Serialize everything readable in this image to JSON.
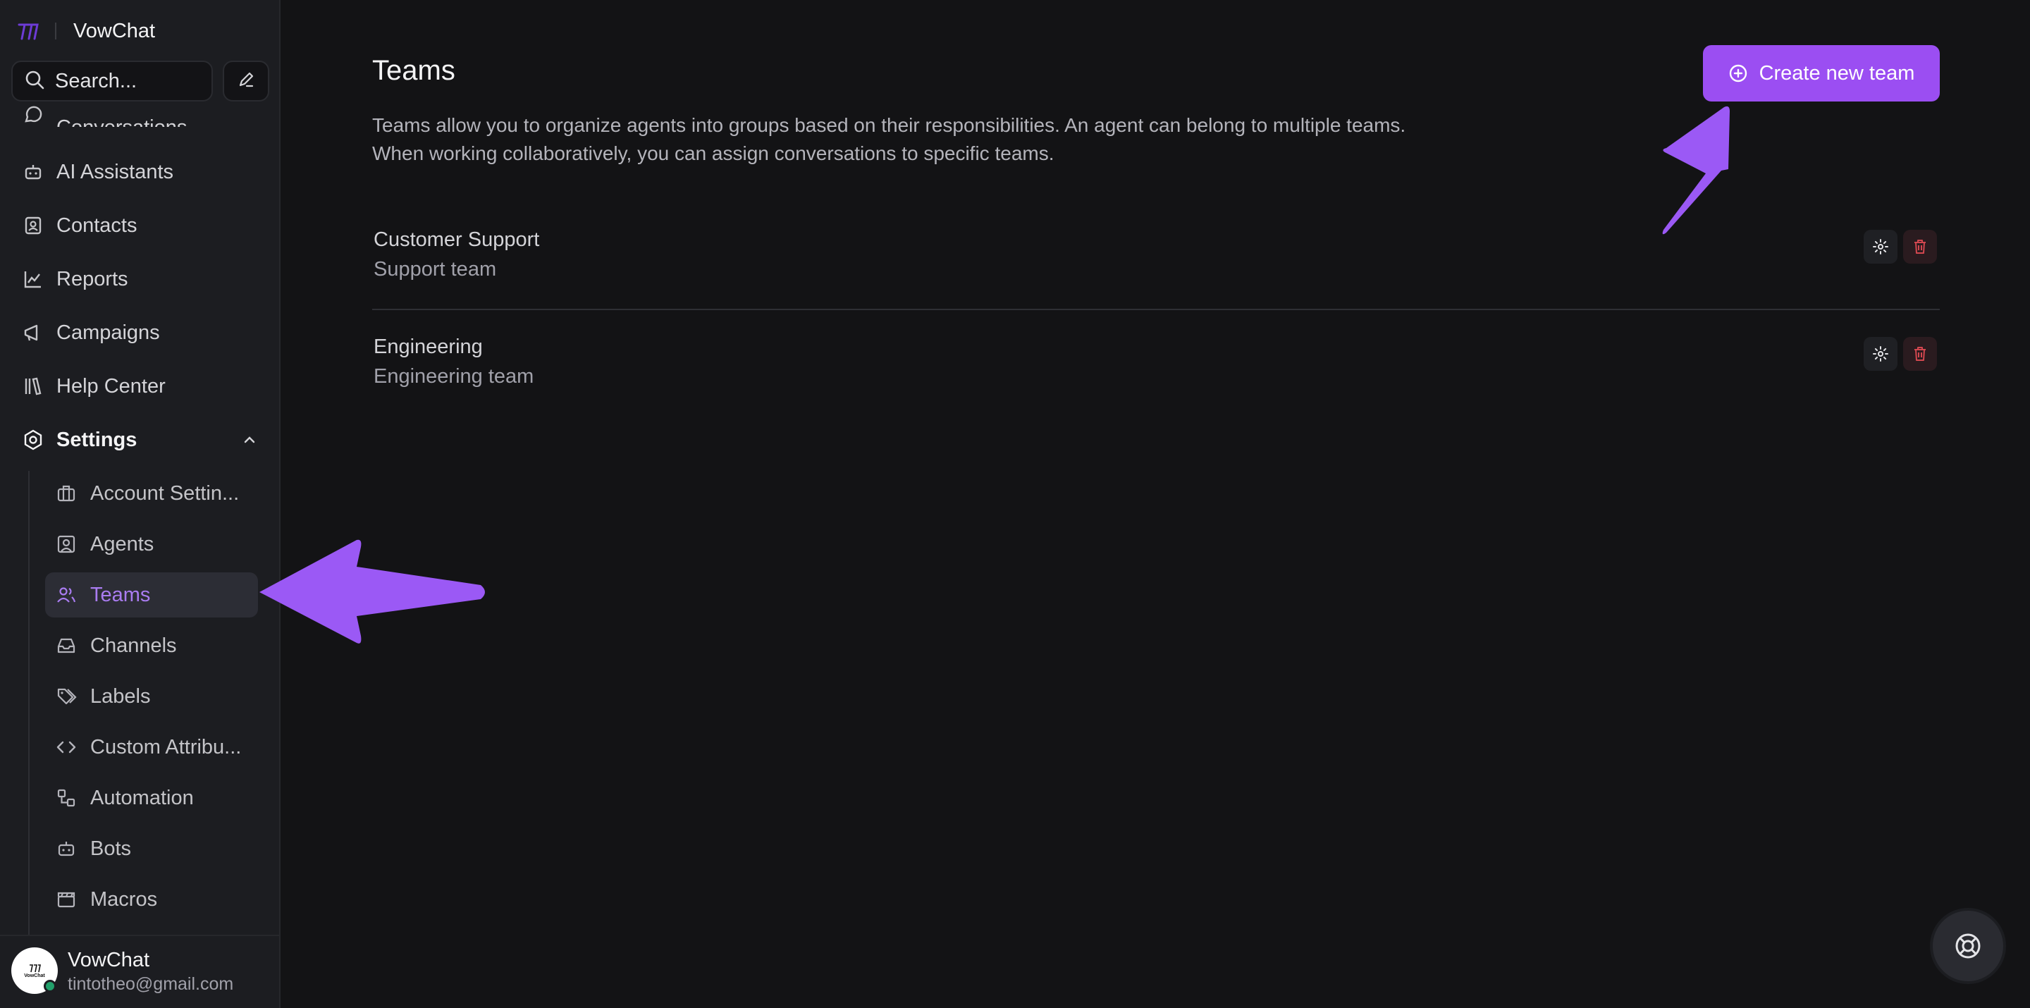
{
  "app": {
    "name": "VowChat"
  },
  "sidebar": {
    "search_label": "Search...",
    "nav": [
      {
        "label": "Conversations",
        "icon": "chat-icon"
      },
      {
        "label": "AI Assistants",
        "icon": "bot-icon"
      },
      {
        "label": "Contacts",
        "icon": "contact-card-icon"
      },
      {
        "label": "Reports",
        "icon": "line-chart-icon"
      },
      {
        "label": "Campaigns",
        "icon": "megaphone-icon"
      },
      {
        "label": "Help Center",
        "icon": "library-icon"
      }
    ],
    "settings": {
      "label": "Settings",
      "icon": "gear-hex-icon"
    },
    "settings_items": [
      {
        "label": "Account Settin...",
        "icon": "briefcase-icon"
      },
      {
        "label": "Agents",
        "icon": "user-square-icon"
      },
      {
        "label": "Teams",
        "icon": "users-icon",
        "active": true
      },
      {
        "label": "Channels",
        "icon": "inbox-icon"
      },
      {
        "label": "Labels",
        "icon": "tags-icon"
      },
      {
        "label": "Custom Attribu...",
        "icon": "code-icon"
      },
      {
        "label": "Automation",
        "icon": "workflow-icon"
      },
      {
        "label": "Bots",
        "icon": "bot-icon"
      },
      {
        "label": "Macros",
        "icon": "clapperboard-icon"
      }
    ],
    "user": {
      "name": "VowChat",
      "email": "tintotheo@gmail.com",
      "avatar_text": "VowChat"
    }
  },
  "main": {
    "title": "Teams",
    "description": "Teams allow you to organize agents into groups based on their responsibilities. An agent can belong to multiple teams. When working collaboratively, you can assign conversations to specific teams.",
    "create_button": "Create new team",
    "teams": [
      {
        "name": "Customer Support",
        "description": "Support team"
      },
      {
        "name": "Engineering",
        "description": "Engineering team"
      }
    ]
  },
  "colors": {
    "accent": "#9b4ef2",
    "active_text": "#a97cf0",
    "annotation_arrow": "#9b59f5",
    "background": "#131315",
    "sidebar": "#1c1d21",
    "danger": "#d2474f"
  }
}
